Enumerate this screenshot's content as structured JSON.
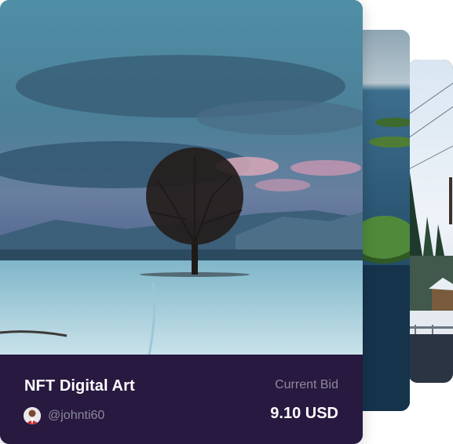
{
  "card": {
    "title": "NFT Digital Art",
    "current_bid_label": "Current Bid",
    "username": "@johnti60",
    "price": "9.10 USD"
  },
  "colors": {
    "info_background": "#27193f",
    "muted_text": "#8d8a9c",
    "primary_text": "#ffffff"
  },
  "images": {
    "front": "tree-snow-landscape",
    "middle": "lake-islands-landscape",
    "back": "snowy-forest-cabin"
  }
}
